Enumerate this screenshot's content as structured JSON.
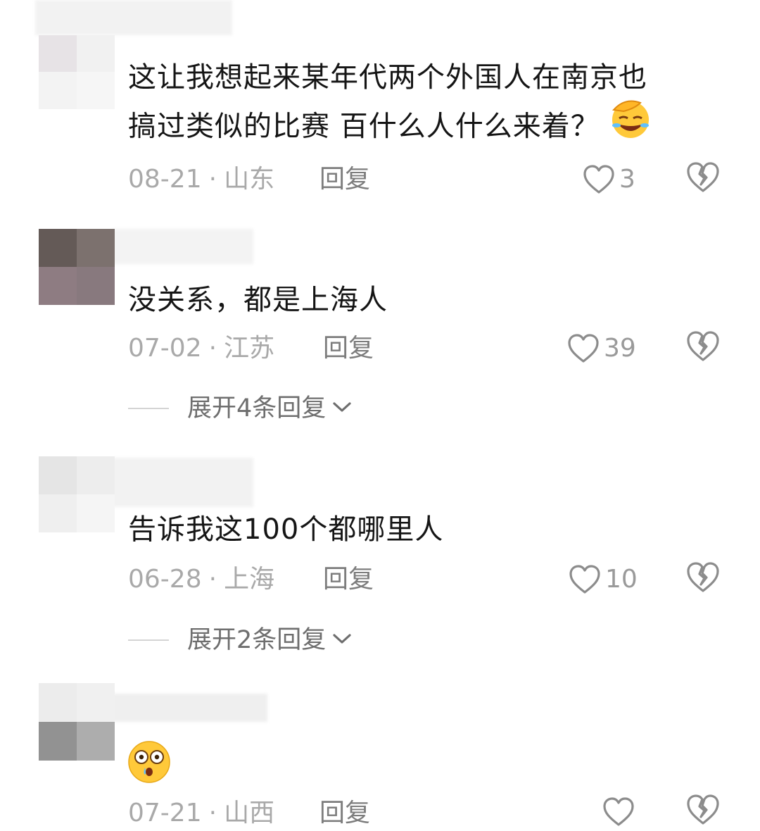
{
  "comments": [
    {
      "text_lines": [
        "这让我想起来某年代两个外国人在南京也",
        "搞过类似的比赛 百什么人什么来着？"
      ],
      "emoji": "facepalm-laugh-emoji",
      "date": "08-21",
      "separator": "·",
      "region": "山东",
      "reply": "回复",
      "likes": "3"
    },
    {
      "text_lines": [
        "没关系，都是上海人"
      ],
      "date": "07-02",
      "separator": "·",
      "region": "江苏",
      "reply": "回复",
      "likes": "39",
      "expand": "展开4条回复"
    },
    {
      "text_lines": [
        "告诉我这100个都哪里人"
      ],
      "date": "06-28",
      "separator": "·",
      "region": "上海",
      "reply": "回复",
      "likes": "10",
      "expand": "展开2条回复"
    },
    {
      "text_lines": [],
      "emoji": "shocked-face-emoji",
      "date": "07-21",
      "separator": "·",
      "region": "山西",
      "reply": "回复",
      "likes": ""
    }
  ],
  "colors": {
    "text": "#151515",
    "meta": "#a9a9a9",
    "reply": "#7d7d7d",
    "icon": "#8c8c8c",
    "emoji_yellow": "#ffc93a"
  }
}
